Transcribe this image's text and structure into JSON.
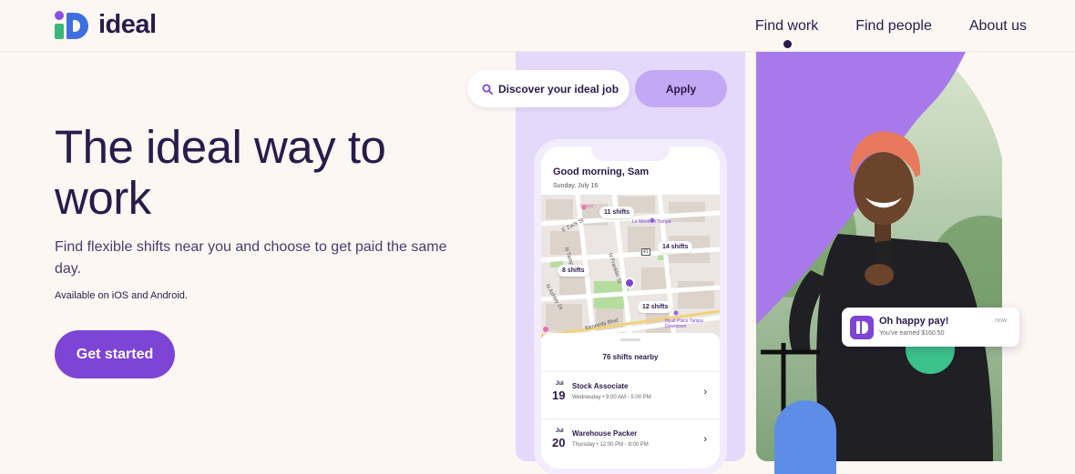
{
  "brand": {
    "name": "ideal"
  },
  "nav": {
    "items": [
      {
        "label": "Find work",
        "active": true
      },
      {
        "label": "Find people",
        "active": false
      },
      {
        "label": "About us",
        "active": false
      }
    ]
  },
  "hero": {
    "title": "The ideal way to work",
    "subtitle": "Find flexible shifts near you and choose to get paid the same day.",
    "availability": "Available on iOS and Android.",
    "cta_label": "Get started"
  },
  "search": {
    "label": "Discover your ideal job",
    "apply_label": "Apply"
  },
  "phone": {
    "greeting": "Good morning, Sam",
    "date": "Sunday, July 16",
    "map_pins": [
      "11 shifts",
      "14 shifts",
      "8 shifts",
      "12 shifts"
    ],
    "map_labels": {
      "street_1": "E Zack St",
      "street_2": "N Franklin St",
      "street_3": "N Ashley Dr",
      "street_4": "Kennedy Blvd",
      "street_5": "N Tampa St",
      "poi_1": "Le Méridien Tampa",
      "poi_2": "Hyatt Place Tampa Downtown",
      "poi_3": "Tampa",
      "route": "41"
    },
    "nearby": "76 shifts nearby",
    "shifts": [
      {
        "month": "Jul",
        "day": "19",
        "title": "Stock Associate",
        "time": "Wednesday • 9:00 AM - 5:00 PM"
      },
      {
        "month": "Jul",
        "day": "20",
        "title": "Warehouse Packer",
        "time": "Thursday • 12:00 PM - 8:00 PM"
      }
    ]
  },
  "notification": {
    "title": "Oh happy pay!",
    "subtitle": "You've earned $160.50",
    "time": "now"
  },
  "colors": {
    "background": "#fdf7f3",
    "primary": "#7d44d6",
    "text": "#2b1a4a",
    "lavender": "#e5d9fb",
    "green": "#3cc18a",
    "blue": "#5e8de8"
  }
}
